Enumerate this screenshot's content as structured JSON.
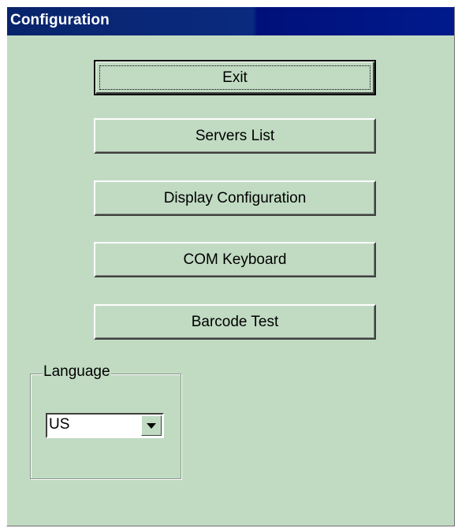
{
  "window": {
    "title": "Configuration"
  },
  "buttons": {
    "exit": "Exit",
    "servers_list": "Servers List",
    "display_configuration": "Display Configuration",
    "com_keyboard": "COM Keyboard",
    "barcode_test": "Barcode Test"
  },
  "language": {
    "group_label": "Language",
    "selected": "US",
    "dropdown_icon": "chevron-down-icon"
  },
  "colors": {
    "window_bg": "#c1dbc3",
    "titlebar": "#08246b",
    "title_text": "#ffffff"
  }
}
